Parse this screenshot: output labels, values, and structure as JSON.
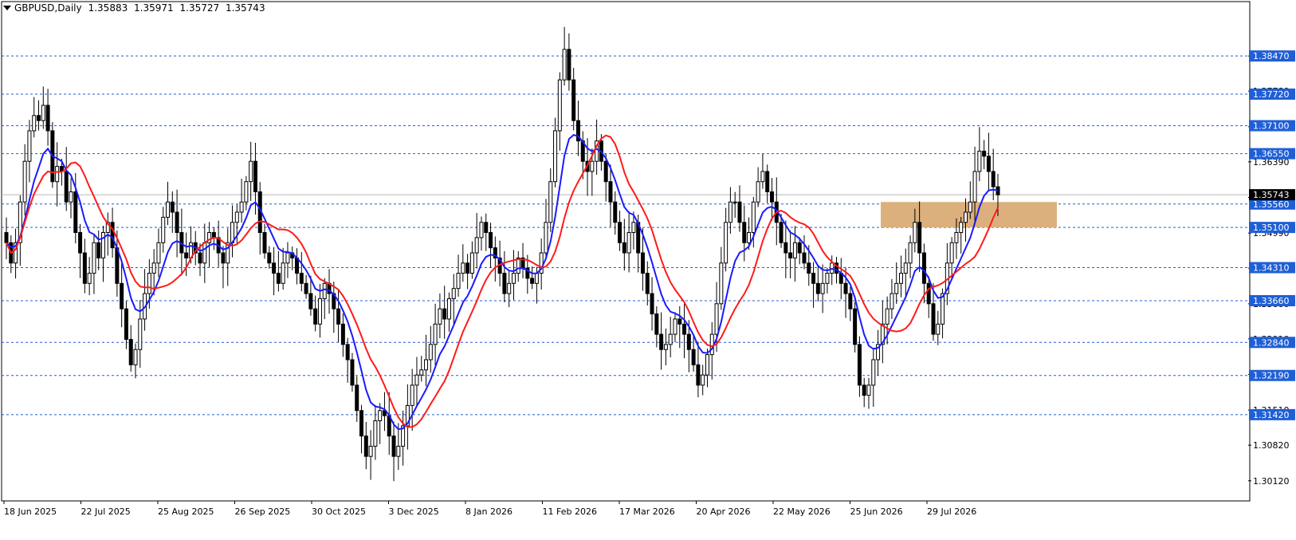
{
  "title_bar": {
    "symbol": "GBPUSD,Daily",
    "open": "1.35883",
    "high": "1.35971",
    "low": "1.35727",
    "close": "1.35743"
  },
  "chart_data": {
    "type": "candlestick",
    "symbol": "GBPUSD",
    "timeframe": "Daily",
    "ylim": [
      1.2985,
      1.391
    ],
    "y_ticks": [
      "1.30120",
      "1.30820",
      "1.31510",
      "1.32210",
      "1.32910",
      "1.33600",
      "1.34300",
      "1.34990",
      "1.35690",
      "1.36390",
      "1.37080",
      "1.37780",
      "1.38470"
    ],
    "x_labels": [
      "18 Jun 2025",
      "22 Jul 2025",
      "25 Aug 2025",
      "26 Sep 2025",
      "30 Oct 2025",
      "3 Dec 2025",
      "8 Jan 2026",
      "11 Feb 2026",
      "17 Mar 2026",
      "20 Apr 2026",
      "22 May 2026",
      "25 Jun 2026",
      "29 Jul 2026"
    ],
    "current_price": {
      "value": 1.35743,
      "label": "1.35743",
      "bg_color": "#000000",
      "text_color": "#ffffff"
    },
    "horizontal_levels": [
      {
        "value": 1.3847,
        "label": "1.38470"
      },
      {
        "value": 1.3772,
        "label": "1.37720"
      },
      {
        "value": 1.371,
        "label": "1.37100"
      },
      {
        "value": 1.3655,
        "label": "1.36550"
      },
      {
        "value": 1.3556,
        "label": "1.35560"
      },
      {
        "value": 1.351,
        "label": "1.35100"
      },
      {
        "value": 1.3431,
        "label": "1.34310"
      },
      {
        "value": 1.3366,
        "label": "1.33660"
      },
      {
        "value": 1.3284,
        "label": "1.32840"
      },
      {
        "value": 1.3219,
        "label": "1.32190"
      },
      {
        "value": 1.3142,
        "label": "1.31420"
      }
    ],
    "level_color": "#1f5fd6",
    "level_label_bg": "#1f5fd6",
    "zone": {
      "from_x": 1078,
      "to_x": 1101,
      "low": 1.351,
      "high": 1.356,
      "color": "#dcb07c"
    },
    "closes": [
      1.348,
      1.344,
      1.348,
      1.356,
      1.364,
      1.37,
      1.373,
      1.372,
      1.375,
      1.37,
      1.36,
      1.363,
      1.362,
      1.356,
      1.358,
      1.35,
      1.346,
      1.34,
      1.342,
      1.348,
      1.345,
      1.35,
      1.352,
      1.347,
      1.34,
      1.335,
      1.329,
      1.324,
      1.327,
      1.333,
      1.338,
      1.342,
      1.344,
      1.348,
      1.353,
      1.356,
      1.354,
      1.35,
      1.346,
      1.345,
      1.348,
      1.346,
      1.344,
      1.348,
      1.35,
      1.349,
      1.346,
      1.344,
      1.348,
      1.352,
      1.354,
      1.356,
      1.36,
      1.364,
      1.358,
      1.35,
      1.346,
      1.344,
      1.342,
      1.34,
      1.344,
      1.346,
      1.345,
      1.342,
      1.34,
      1.338,
      1.335,
      1.332,
      1.337,
      1.34,
      1.338,
      1.335,
      1.332,
      1.328,
      1.325,
      1.32,
      1.315,
      1.31,
      1.306,
      1.308,
      1.313,
      1.315,
      1.314,
      1.31,
      1.306,
      1.308,
      1.312,
      1.316,
      1.32,
      1.322,
      1.323,
      1.325,
      1.328,
      1.332,
      1.335,
      1.333,
      1.337,
      1.339,
      1.342,
      1.344,
      1.342,
      1.346,
      1.349,
      1.352,
      1.35,
      1.347,
      1.345,
      1.342,
      1.338,
      1.34,
      1.342,
      1.345,
      1.343,
      1.341,
      1.34,
      1.342,
      1.346,
      1.352,
      1.36,
      1.37,
      1.38,
      1.386,
      1.38,
      1.372,
      1.368,
      1.364,
      1.362,
      1.364,
      1.368,
      1.364,
      1.36,
      1.356,
      1.352,
      1.348,
      1.346,
      1.35,
      1.352,
      1.346,
      1.342,
      1.338,
      1.334,
      1.33,
      1.327,
      1.328,
      1.33,
      1.333,
      1.332,
      1.33,
      1.327,
      1.324,
      1.32,
      1.322,
      1.326,
      1.33,
      1.336,
      1.344,
      1.352,
      1.356,
      1.356,
      1.352,
      1.348,
      1.35,
      1.356,
      1.36,
      1.362,
      1.358,
      1.356,
      1.352,
      1.348,
      1.346,
      1.345,
      1.348,
      1.346,
      1.344,
      1.342,
      1.34,
      1.338,
      1.34,
      1.342,
      1.344,
      1.342,
      1.34,
      1.338,
      1.335,
      1.328,
      1.32,
      1.318,
      1.32,
      1.325,
      1.328,
      1.332,
      1.335,
      1.338,
      1.34,
      1.342,
      1.344,
      1.348,
      1.352,
      1.346,
      1.34,
      1.336,
      1.33,
      1.332,
      1.338,
      1.344,
      1.348,
      1.35,
      1.352,
      1.354,
      1.356,
      1.362,
      1.366,
      1.365,
      1.362,
      1.359,
      1.3574
    ]
  }
}
